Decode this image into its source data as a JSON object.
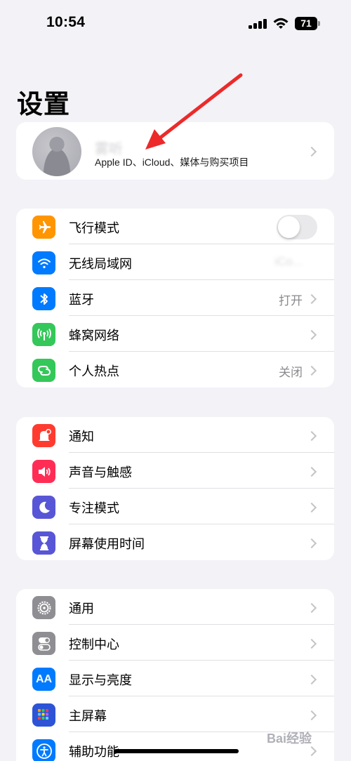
{
  "status_bar": {
    "time": "10:54",
    "battery": "71"
  },
  "title": "设置",
  "profile": {
    "name": "雾听",
    "subtitle": "Apple ID、iCloud、媒体与购买项目"
  },
  "group1": [
    {
      "label": "飞行模式",
      "icon": "airplane-icon",
      "color": "#ff9500",
      "control": "toggle",
      "toggle_on": false
    },
    {
      "label": "无线局域网",
      "icon": "wifi-icon",
      "color": "#007aff",
      "value": "iCo..."
    },
    {
      "label": "蓝牙",
      "icon": "bluetooth-icon",
      "color": "#007aff",
      "value": "打开"
    },
    {
      "label": "蜂窝网络",
      "icon": "antenna-icon",
      "color": "#34c759"
    },
    {
      "label": "个人热点",
      "icon": "hotspot-icon",
      "color": "#34c759",
      "value": "关闭"
    }
  ],
  "group2": [
    {
      "label": "通知",
      "icon": "bell-icon",
      "color": "#ff3b30"
    },
    {
      "label": "声音与触感",
      "icon": "speaker-icon",
      "color": "#ff2d55"
    },
    {
      "label": "专注模式",
      "icon": "moon-icon",
      "color": "#5856d6"
    },
    {
      "label": "屏幕使用时间",
      "icon": "hourglass-icon",
      "color": "#5856d6"
    }
  ],
  "group3": [
    {
      "label": "通用",
      "icon": "gear-icon",
      "color": "#8e8e93"
    },
    {
      "label": "控制中心",
      "icon": "switches-icon",
      "color": "#8e8e93"
    },
    {
      "label": "显示与亮度",
      "icon": "display-icon",
      "color": "#007aff"
    },
    {
      "label": "主屏幕",
      "icon": "homescreen-icon",
      "color": "#2d54d6"
    },
    {
      "label": "辅助功能",
      "icon": "accessibility-icon",
      "color": "#007aff"
    }
  ],
  "watermark": "Bai经验"
}
